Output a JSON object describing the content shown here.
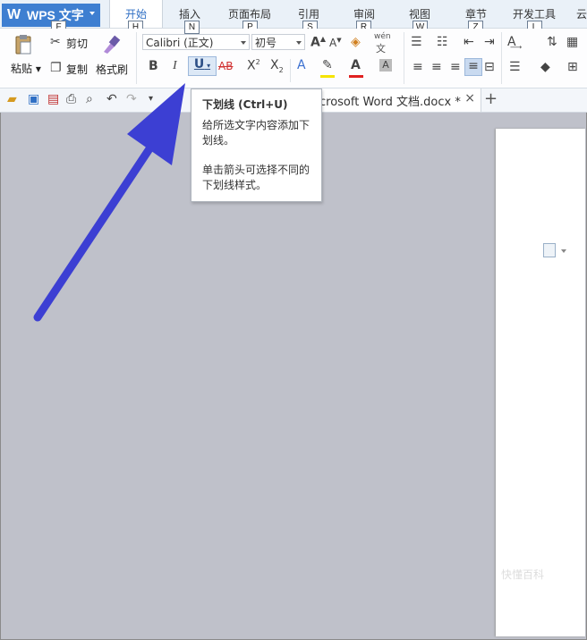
{
  "app": {
    "title": "WPS 文字",
    "logo": "W"
  },
  "menu_tabs": [
    {
      "label": "开始",
      "key": "H",
      "active": true
    },
    {
      "label": "插入",
      "key": "N"
    },
    {
      "label": "页面布局",
      "key": "P"
    },
    {
      "label": "引用",
      "key": "S"
    },
    {
      "label": "审阅",
      "key": "R"
    },
    {
      "label": "视图",
      "key": "W"
    },
    {
      "label": "章节",
      "key": "Z"
    },
    {
      "label": "开发工具",
      "key": "L"
    },
    {
      "label": "云"
    }
  ],
  "app_key": "F",
  "ribbon": {
    "paste_label": "粘贴",
    "cut_label": "剪切",
    "copy_label": "复制",
    "format_painter_label": "格式刷",
    "font_name": "Calibri (正文)",
    "font_size": "初号",
    "phonetic_label": "wén",
    "phonetic_char": "文"
  },
  "document_tab": {
    "title": "crosoft Word 文档.docx *",
    "close": "×"
  },
  "new_tab_symbol": "+",
  "tooltip": {
    "title": "下划线 (Ctrl+U)",
    "description": "给所选文字内容添加下划线。",
    "hint": "单击箭头可选择不同的下划线样式。"
  },
  "colors": {
    "accent": "#3e7fd1",
    "arrow": "#3c3fd3",
    "canvas": "#bfc1ca",
    "font_color_bar": "#e02020",
    "highlight_bar": "#f5e400"
  },
  "watermark": "快懂百科"
}
